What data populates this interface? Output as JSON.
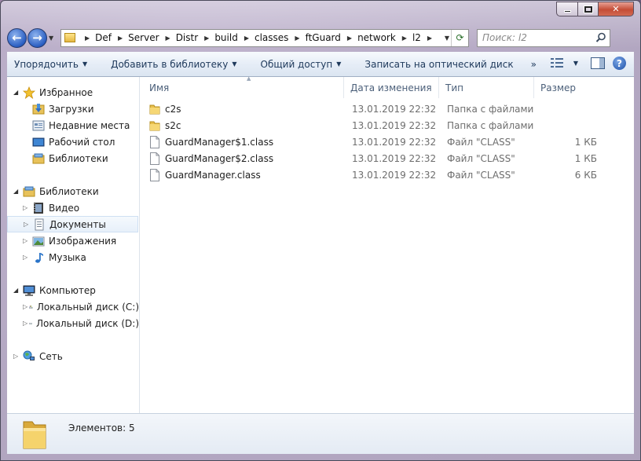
{
  "address": {
    "crumbs": [
      "Def",
      "Server",
      "Distr",
      "build",
      "classes",
      "ftGuard",
      "network",
      "l2"
    ]
  },
  "search": {
    "placeholder": "Поиск: l2"
  },
  "toolbar": {
    "organize": "Упорядочить",
    "add_to_library": "Добавить в библиотеку",
    "share": "Общий доступ",
    "burn": "Записать на оптический диск",
    "more": "»"
  },
  "sidebar": {
    "favorites": {
      "label": "Избранное",
      "items": [
        "Загрузки",
        "Недавние места",
        "Рабочий стол",
        "Библиотеки"
      ]
    },
    "libraries": {
      "label": "Библиотеки",
      "items": [
        "Видео",
        "Документы",
        "Изображения",
        "Музыка"
      ]
    },
    "computer": {
      "label": "Компьютер",
      "items": [
        "Локальный диск (C:)",
        "Локальный диск (D:)"
      ]
    },
    "network": {
      "label": "Сеть"
    }
  },
  "columns": {
    "name": "Имя",
    "date": "Дата изменения",
    "type": "Тип",
    "size": "Размер"
  },
  "files": [
    {
      "name": "c2s",
      "date": "13.01.2019 22:32",
      "type": "Папка с файлами",
      "size": ""
    },
    {
      "name": "s2c",
      "date": "13.01.2019 22:32",
      "type": "Папка с файлами",
      "size": ""
    },
    {
      "name": "GuardManager$1.class",
      "date": "13.01.2019 22:32",
      "type": "Файл \"CLASS\"",
      "size": "1 КБ"
    },
    {
      "name": "GuardManager$2.class",
      "date": "13.01.2019 22:32",
      "type": "Файл \"CLASS\"",
      "size": "1 КБ"
    },
    {
      "name": "GuardManager.class",
      "date": "13.01.2019 22:32",
      "type": "Файл \"CLASS\"",
      "size": "6 КБ"
    }
  ],
  "status": {
    "text": "Элементов: 5"
  }
}
